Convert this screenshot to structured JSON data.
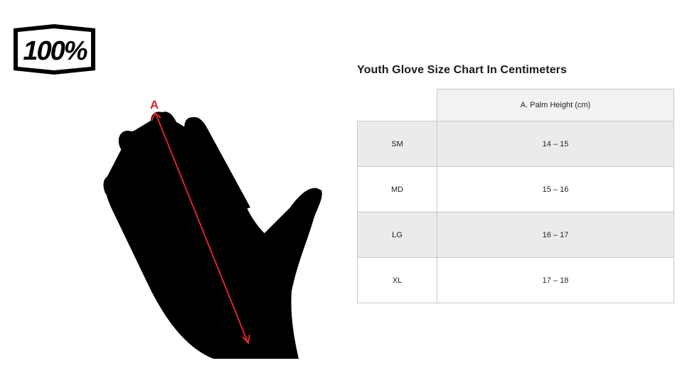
{
  "brand": {
    "logo_text": "100%"
  },
  "diagram": {
    "measure_label": "A"
  },
  "chart": {
    "title": "Youth Glove Size Chart In Centimeters",
    "column_header": "A. Palm Height (cm)",
    "rows": [
      {
        "size": "SM",
        "value": "14 – 15"
      },
      {
        "size": "MD",
        "value": "15 – 16"
      },
      {
        "size": "LG",
        "value": "16 – 17"
      },
      {
        "size": "XL",
        "value": "17 – 18"
      }
    ]
  },
  "colors": {
    "accent_red": "#d8262e",
    "silhouette": "#000000",
    "row_shade": "#ebebeb"
  }
}
